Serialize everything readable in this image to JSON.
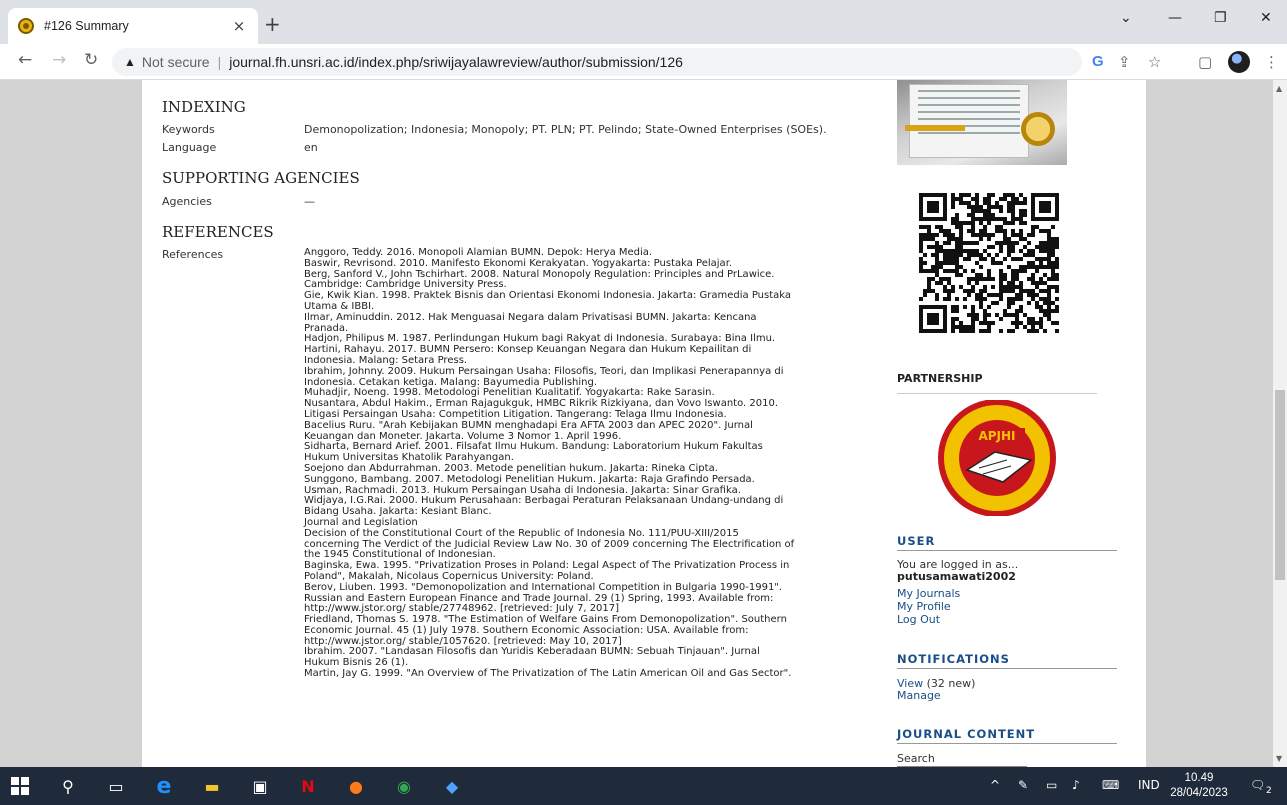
{
  "browser": {
    "tab_title": "#126 Summary",
    "tab_close": "×",
    "new_tab": "+",
    "not_secure": "Not secure",
    "separator": "|",
    "url": "journal.fh.unsri.ac.id/index.php/sriwijayalawreview/author/submission/126",
    "win_min": "—",
    "win_restore": "❐",
    "win_close": "✕",
    "tab_search": "⌄"
  },
  "content": {
    "indexing_heading": "INDEXING",
    "keywords_label": "Keywords",
    "keywords_value": "Demonopolization; Indonesia; Monopoly; PT. PLN; PT. Pelindo; State-Owned Enterprises (SOEs).",
    "language_label": "Language",
    "language_value": "en",
    "agencies_heading": "SUPPORTING AGENCIES",
    "agencies_label": "Agencies",
    "agencies_value": "—",
    "references_heading": "REFERENCES",
    "references_label": "References",
    "references": [
      "Anggoro, Teddy. 2016. Monopoli Alamian BUMN. Depok: Herya Media.",
      "Baswir, Revrisond. 2010. Manifesto Ekonomi Kerakyatan. Yogyakarta: Pustaka Pelajar.",
      "Berg, Sanford V., John Tschirhart. 2008. Natural Monopoly Regulation: Principles and PrLawice.",
      "Cambridge: Cambridge University Press.",
      "Gie, Kwik Kian. 1998. Praktek Bisnis dan Orientasi Ekonomi Indonesia. Jakarta: Gramedia Pustaka",
      "Utama & IBBI.",
      "Ilmar, Aminuddin. 2012. Hak Menguasai Negara dalam Privatisasi BUMN. Jakarta: Kencana",
      "Pranada.",
      "Hadjon, Philipus M. 1987. Perlindungan Hukum bagi Rakyat di Indonesia. Surabaya: Bina Ilmu.",
      "Hartini, Rahayu. 2017. BUMN Persero: Konsep Keuangan Negara dan Hukum Kepailitan di",
      "Indonesia. Malang: Setara Press.",
      "Ibrahim, Johnny. 2009. Hukum Persaingan Usaha: Filosofis, Teori, dan Implikasi Penerapannya di",
      "Indonesia. Cetakan ketiga. Malang: Bayumedia Publishing.",
      "Muhadjir, Noeng. 1998. Metodologi Penelitian Kualitatif. Yogyakarta: Rake Sarasin.",
      "Nusantara, Abdul Hakim., Erman Rajagukguk, HMBC Rikrik Rizkiyana, dan Vovo Iswanto. 2010.",
      "Litigasi Persaingan Usaha: Competition Litigation. Tangerang: Telaga Ilmu Indonesia.",
      "Bacelius Ruru. \"Arah Kebijakan BUMN menghadapi Era AFTA 2003 dan APEC 2020\". Jurnal",
      "Keuangan dan Moneter. Jakarta. Volume 3 Nomor 1. April 1996.",
      "Sidharta, Bernard Arief. 2001. Filsafat Ilmu Hukum. Bandung: Laboratorium Hukum Fakultas",
      "Hukum Universitas Khatolik Parahyangan.",
      "Soejono dan Abdurrahman. 2003. Metode penelitian hukum. Jakarta: Rineka Cipta.",
      "Sunggono, Bambang. 2007. Metodologi Penelitian Hukum. Jakarta: Raja Grafindo Persada.",
      "Usman, Rachmadi. 2013. Hukum Persaingan Usaha di Indonesia. Jakarta: Sinar Grafika.",
      "Widjaya, I.G.Rai. 2000. Hukum Perusahaan: Berbagai Peraturan Pelaksanaan Undang-undang di",
      "Bidang Usaha. Jakarta: Kesiant Blanc.",
      "Journal and Legislation",
      "Decision of the Constitutional Court of the Republic of Indonesia No. 111/PUU-XIII/2015",
      "concerning The Verdict of the Judicial Review Law No. 30 of 2009 concerning The Electrification of",
      "the 1945 Constitutional of Indonesian.",
      "Baginska, Ewa. 1995. \"Privatization Proses in Poland: Legal Aspect of The Privatization Process in",
      "Poland\", Makalah, Nicolaus Copernicus University: Poland.",
      "Berov, Liuben. 1993. \"Demonopolization and International Competition in Bulgaria 1990-1991\".",
      "Russian and Eastern European Finance and Trade Journal. 29 (1) Spring, 1993. Available from:",
      "http://www.jstor.org/ stable/27748962. [retrieved: July 7, 2017]",
      "Friedland, Thomas S. 1978. \"The Estimation of Welfare Gains From Demonopolization\". Southern",
      "Economic Journal. 45 (1) July 1978. Southern Economic Association: USA. Available from:",
      "http://www.jstor.org/ stable/1057620. [retrieved: May 10, 2017]",
      "Ibrahim. 2007. \"Landasan Filosofis dan Yuridis Keberadaan BUMN: Sebuah Tinjauan\". Jurnal",
      "Hukum Bisnis 26 (1).",
      "Martin, Jay G. 1999. \"An Overview of The Privatization of The Latin American Oil and Gas Sector\"."
    ]
  },
  "sidebar": {
    "partnership_heading": "PARTNERSHIP",
    "apjhi_text": "APJHI",
    "user_heading": "USER",
    "logged_in_as": "You are logged in as...",
    "username": "putusamawati2002",
    "my_journals": "My Journals",
    "my_profile": "My Profile",
    "log_out": "Log Out",
    "notifications_heading": "NOTIFICATIONS",
    "view_link": "View",
    "new_count": "(32 new)",
    "manage_link": "Manage",
    "journal_content_heading": "JOURNAL CONTENT",
    "search_label": "Search"
  },
  "taskbar": {
    "language": "IND",
    "time": "10.49",
    "date": "28/04/2023",
    "notification_count": "2"
  },
  "colors": {
    "link": "#1a4e86",
    "taskbar": "#1f2b3a",
    "page_bg": "#d2d2d2"
  }
}
